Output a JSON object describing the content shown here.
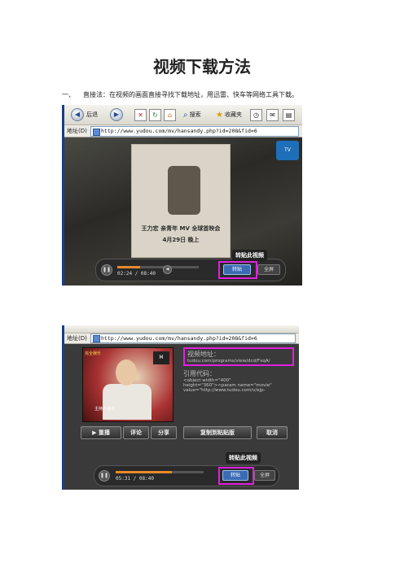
{
  "doc": {
    "title": "视频下载方法",
    "intro_number": "一、",
    "intro_text": "直接法：在视频的画面直接寻找下载地址，用迅雷、快车等网络工具下载。"
  },
  "figure1": {
    "toolbar": {
      "back_label": "后退",
      "search_label": "搜索",
      "favorites_label": "收藏夹"
    },
    "address_label": "地址(D)",
    "address_url": "http://www.yudou.com/mv/hansandy.php?id=208&fid=6",
    "poster_line1": "王力宏 亲青年 MV 全球首映会",
    "poster_line2": "4月29日 晚上",
    "player": {
      "time": "02:24 / 08:40",
      "repost_label": "转贴",
      "other_label": "全屏",
      "tooltip": "转贴此视频"
    }
  },
  "figure2": {
    "address_label": "地址(D)",
    "address_url": "http://www.yudou.com/mv/hansandy.php?id=208&fid=6",
    "video_tag": "完全娱乐",
    "logo": "M",
    "caption": "主持人讲话",
    "panel": {
      "link_label": "视频地址：",
      "link_value": "tudou.com/programs/view/dcd/FvqA/",
      "embed_label": "引用代码：",
      "embed_line1": "<object width=\"400\"",
      "embed_line2": "height=\"360\"><param name=\"movie\"",
      "embed_line3": "value=\"http://www.tudou.com/v/ejp-"
    },
    "buttons": {
      "replay": "▶ 重播",
      "comment": "评论",
      "share": "分享",
      "copy": "复制到粘贴版",
      "cancel": "取消"
    },
    "player": {
      "time": "05:31 / 08:40",
      "repost_label": "转贴",
      "other_label": "全屏",
      "tooltip": "转贴此视频"
    }
  }
}
